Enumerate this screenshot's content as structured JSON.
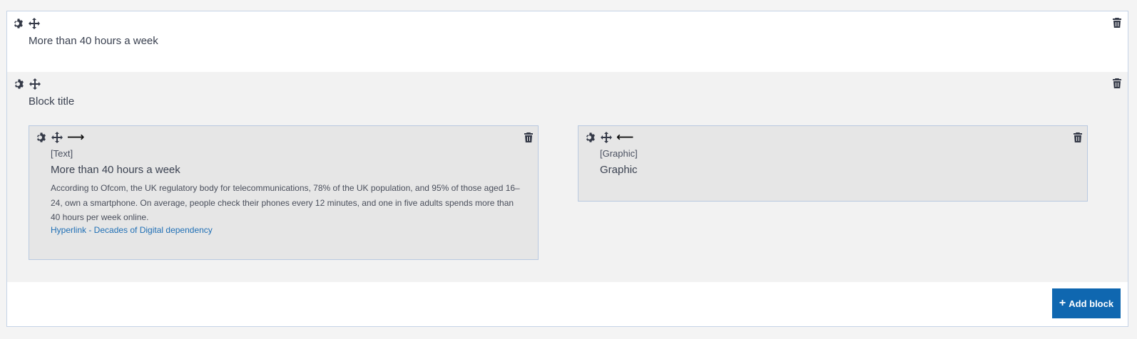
{
  "block1": {
    "title": "More than 40 hours a week",
    "icons": {
      "settings": "gear-icon",
      "move": "move-arrows-icon",
      "delete": "trash-icon"
    }
  },
  "block2": {
    "title": "Block title",
    "left": {
      "tag": "[Text]",
      "title": "More than 40 hours a week",
      "body": "According to Ofcom, the UK regulatory body for telecommunications, 78% of the UK population, and 95% of those aged 16–24, own a smartphone. On average, people check their phones every 12 minutes, and one in five adults spends more than 40 hours per week online.",
      "link": "Hyperlink - Decades of Digital dependency",
      "arrow": "⟶",
      "arrow_icon": "arrow-right-icon"
    },
    "right": {
      "tag": "[Graphic]",
      "title": "Graphic",
      "arrow": "⟵",
      "arrow_icon": "arrow-left-icon"
    }
  },
  "footer": {
    "add_block_icon": "+",
    "add_block_label": "Add block"
  },
  "colors": {
    "accent": "#0f67b0",
    "link": "#1f6fb5",
    "border": "#c5d3e6",
    "sub_background": "#e6e6e6"
  }
}
